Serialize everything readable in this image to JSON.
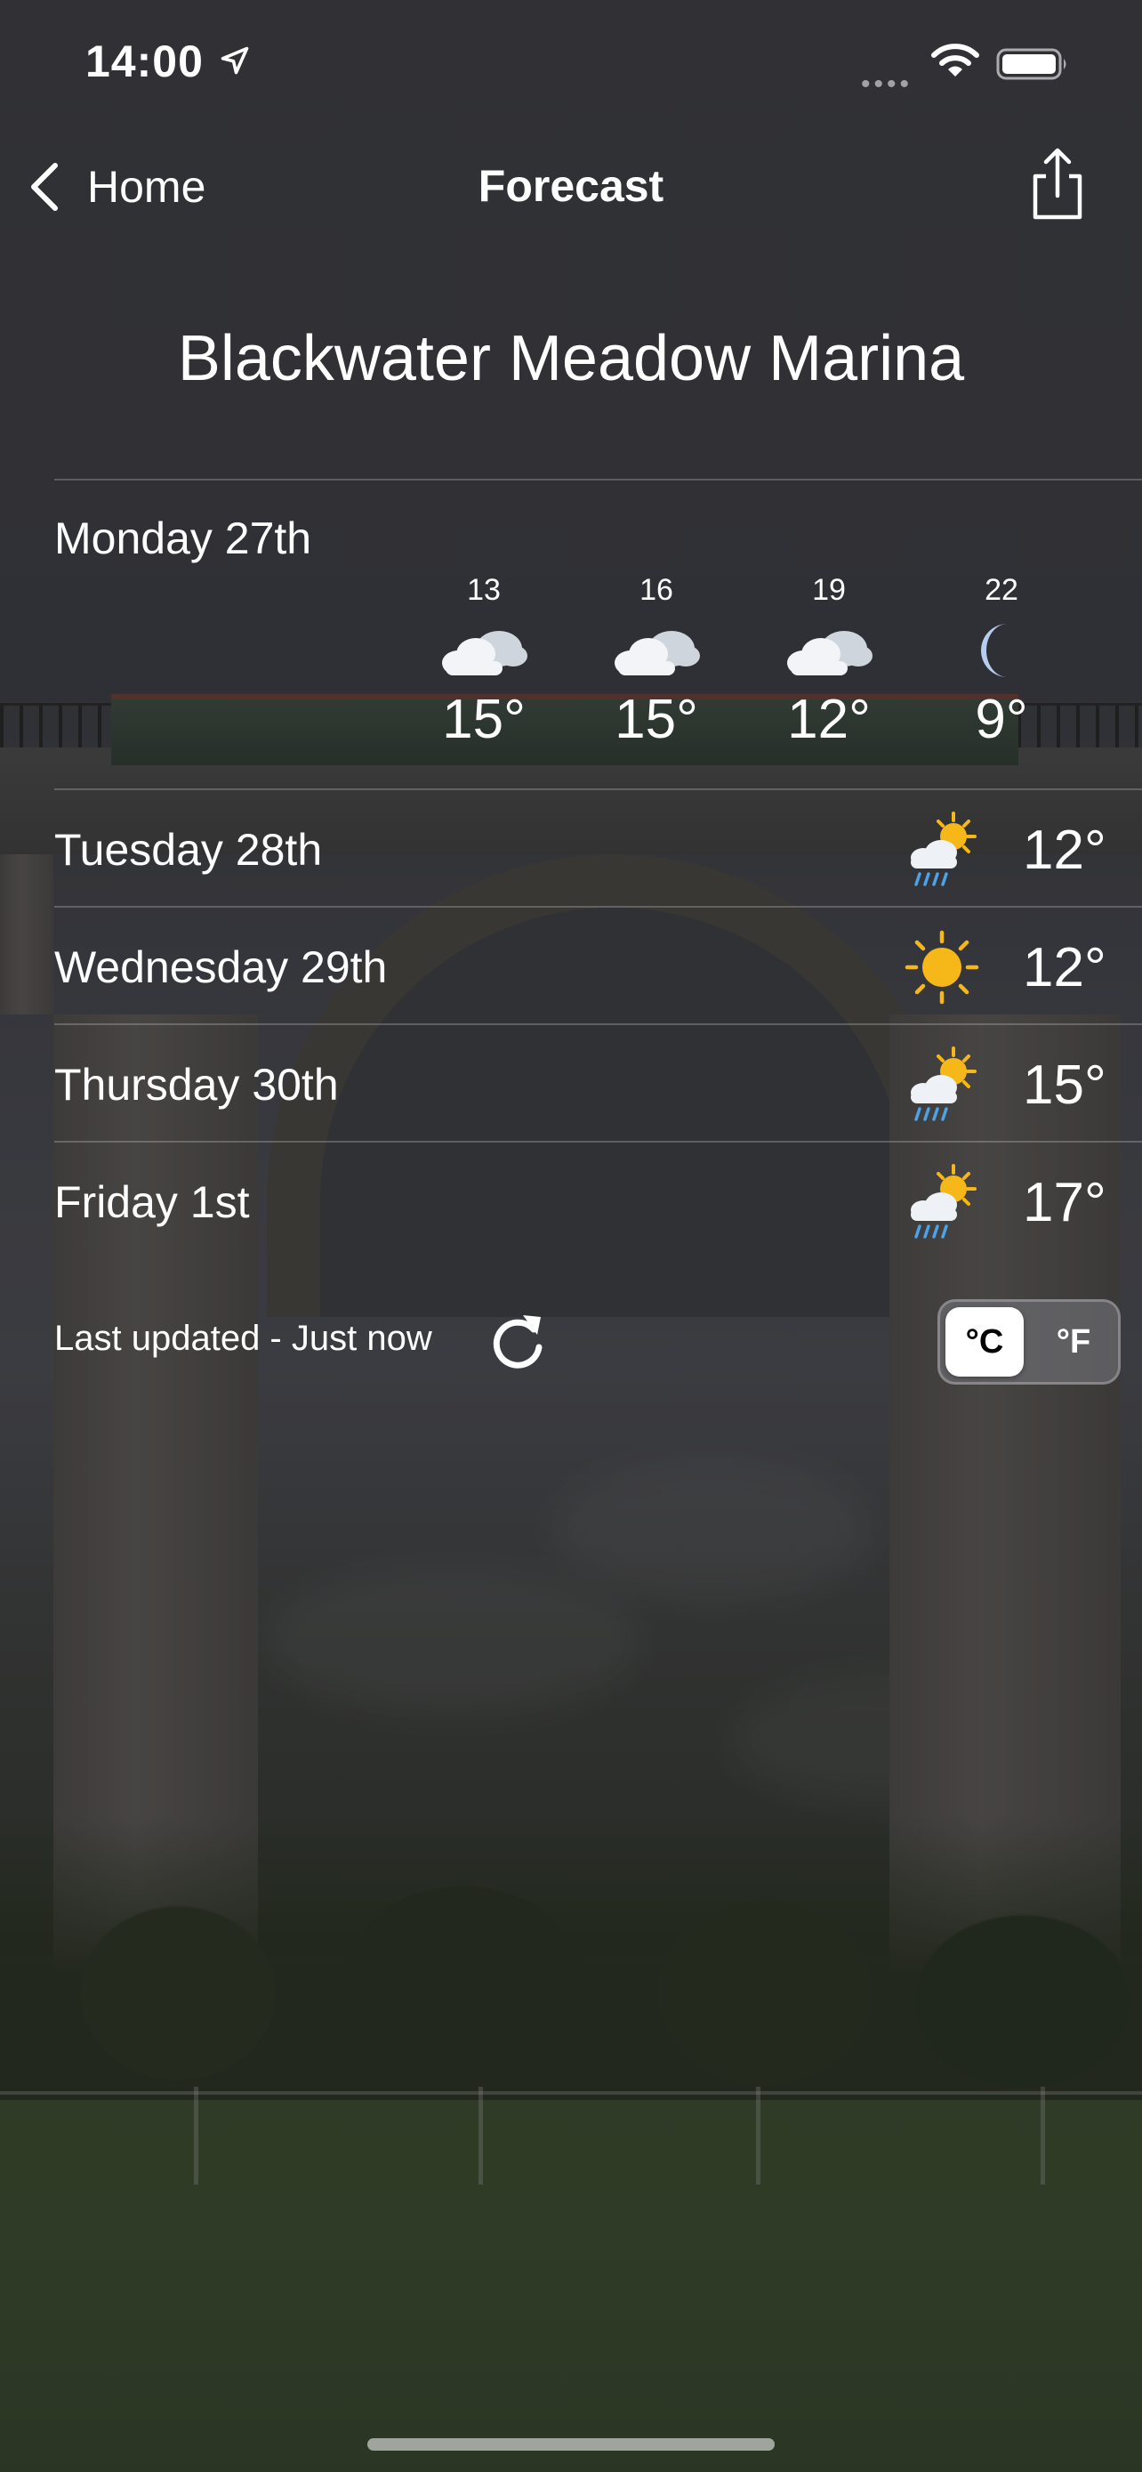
{
  "status_bar": {
    "time": "14:00",
    "signal": "••••"
  },
  "nav": {
    "back_label": "Home",
    "title": "Forecast",
    "share_icon": "share-icon"
  },
  "location": "Blackwater Meadow Marina",
  "today": {
    "label": "Monday 27th",
    "hourly": [
      {
        "hour": "13",
        "icon": "cloudy-icon",
        "temp": "15°"
      },
      {
        "hour": "16",
        "icon": "cloudy-icon",
        "temp": "15°"
      },
      {
        "hour": "19",
        "icon": "cloudy-icon",
        "temp": "12°"
      },
      {
        "hour": "22",
        "icon": "moon-icon",
        "temp": "9°"
      }
    ]
  },
  "days": [
    {
      "label": "Tuesday 28th",
      "icon": "sun-rain-icon",
      "temp": "12°"
    },
    {
      "label": "Wednesday 29th",
      "icon": "sun-icon",
      "temp": "12°"
    },
    {
      "label": "Thursday 30th",
      "icon": "sun-rain-icon",
      "temp": "15°"
    },
    {
      "label": "Friday 1st",
      "icon": "sun-rain-icon",
      "temp": "17°"
    }
  ],
  "footer": {
    "updated": "Last updated - Just now",
    "unit_celsius": "°C",
    "unit_fahrenheit": "°F",
    "selected_unit": "°C"
  },
  "colors": {
    "text": "#ffffff",
    "sun": "#f5b818",
    "cloud": "#eef1f5",
    "rain": "#4da3e8",
    "toggle_selected_bg": "#ffffff"
  }
}
